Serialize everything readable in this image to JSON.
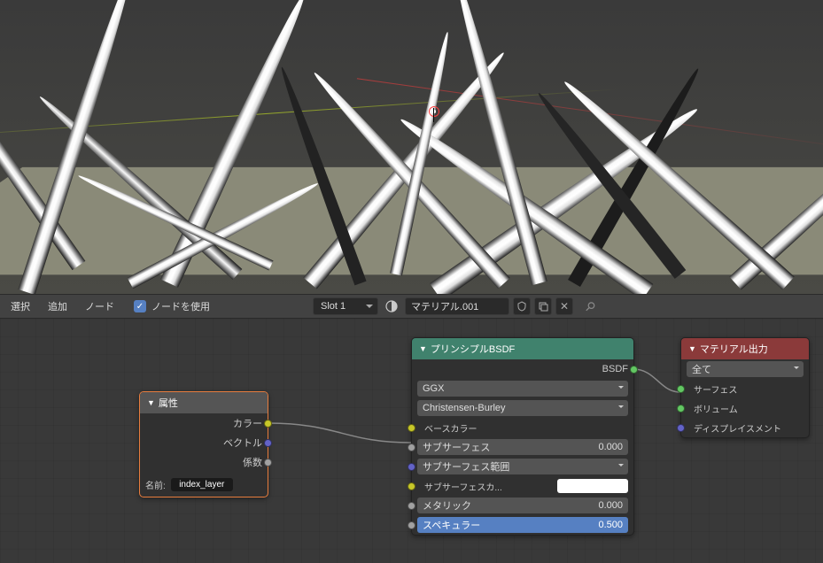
{
  "header": {
    "menu_select": "選択",
    "menu_add": "追加",
    "menu_node": "ノード",
    "use_nodes_label": "ノードを使用",
    "slot": "Slot 1",
    "material": "マテリアル.001"
  },
  "nodes": {
    "attribute": {
      "title": "属性",
      "outputs": {
        "color": "カラー",
        "vector": "ベクトル",
        "factor": "係数"
      },
      "name_label": "名前:",
      "name_value": "index_layer"
    },
    "principled": {
      "title": "プリンシプルBSDF",
      "out_bsdf": "BSDF",
      "distribution": "GGX",
      "subsurface_method": "Christensen-Burley",
      "base_color": "ベースカラー",
      "subsurface": "サブサーフェス",
      "subsurface_val": "0.000",
      "subsurface_radius": "サブサーフェス範囲",
      "subsurface_color": "サブサーフェスカ...",
      "metallic": "メタリック",
      "metallic_val": "0.000",
      "specular": "スペキュラー",
      "specular_val": "0.500"
    },
    "output": {
      "title": "マテリアル出力",
      "target": "全て",
      "surface": "サーフェス",
      "volume": "ボリューム",
      "displacement": "ディスプレイスメント"
    }
  }
}
